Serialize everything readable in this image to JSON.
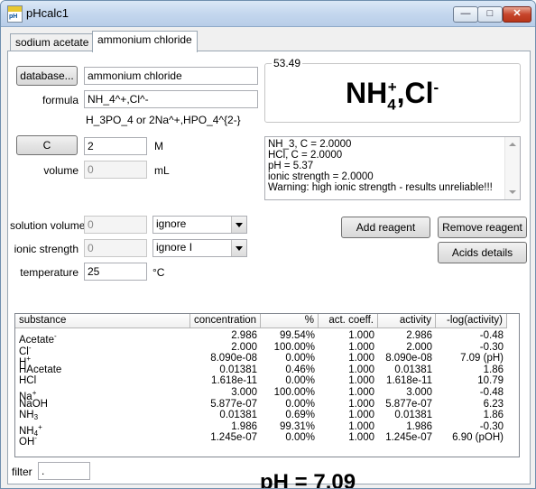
{
  "window": {
    "title": "pHcalc1",
    "minimize": "—",
    "maximize": "□",
    "close": "✕"
  },
  "tabs": [
    {
      "label": "sodium acetate"
    },
    {
      "label": "ammonium chloride"
    }
  ],
  "reagent": {
    "database_button": "database...",
    "name_value": "ammonium chloride",
    "formula_label": "formula",
    "formula_value": "NH_4^+,Cl^-",
    "formula_hint": "H_3PO_4 or 2Na^+,HPO_4^{2-}",
    "c_button": "C",
    "c_value": "2",
    "c_unit": "M",
    "volume_label": "volume",
    "volume_value": "0",
    "volume_unit": "mL"
  },
  "formula_display": {
    "molar_mass": "53.49",
    "base1": "NH",
    "sub1": "4",
    "sup1": "+",
    "sep": ",Cl",
    "sup2": "-"
  },
  "info_lines": [
    "NH_3, C = 2.0000",
    "HCl, C = 2.0000",
    "pH = 5.37",
    "ionic strength = 2.0000",
    "Warning: high ionic strength - results unreliable!!!"
  ],
  "solution": {
    "volume_label": "solution volume",
    "volume_value": "0",
    "volume_mode": "ignore",
    "ionic_label": "ionic strength",
    "ionic_value": "0",
    "ionic_mode": "ignore I",
    "temp_label": "temperature",
    "temp_value": "25",
    "temp_unit": "°C"
  },
  "buttons": {
    "add_reagent": "Add reagent",
    "remove_reagent": "Remove reagent",
    "acids_details": "Acids details"
  },
  "table": {
    "columns": [
      "substance",
      "concentration",
      "%",
      "act. coeff.",
      "activity",
      "-log(activity)"
    ],
    "rows": [
      {
        "name": "Acetate",
        "sub": "",
        "sup": "-",
        "conc": "2.986",
        "pct": "99.54%",
        "coeff": "1.000",
        "act": "2.986",
        "log": "-0.48"
      },
      {
        "name": "Cl",
        "sub": "",
        "sup": "-",
        "conc": "2.000",
        "pct": "100.00%",
        "coeff": "1.000",
        "act": "2.000",
        "log": "-0.30"
      },
      {
        "name": "H",
        "sub": "",
        "sup": "+",
        "conc": "8.090e-08",
        "pct": "0.00%",
        "coeff": "1.000",
        "act": "8.090e-08",
        "log": "7.09 (pH)"
      },
      {
        "name": "HAcetate",
        "sub": "",
        "sup": "",
        "conc": "0.01381",
        "pct": "0.46%",
        "coeff": "1.000",
        "act": "0.01381",
        "log": "1.86"
      },
      {
        "name": "HCl",
        "sub": "",
        "sup": "",
        "conc": "1.618e-11",
        "pct": "0.00%",
        "coeff": "1.000",
        "act": "1.618e-11",
        "log": "10.79"
      },
      {
        "name": "Na",
        "sub": "",
        "sup": "+",
        "conc": "3.000",
        "pct": "100.00%",
        "coeff": "1.000",
        "act": "3.000",
        "log": "-0.48"
      },
      {
        "name": "NaOH",
        "sub": "",
        "sup": "",
        "conc": "5.877e-07",
        "pct": "0.00%",
        "coeff": "1.000",
        "act": "5.877e-07",
        "log": "6.23"
      },
      {
        "name": "NH",
        "sub": "3",
        "sup": "",
        "conc": "0.01381",
        "pct": "0.69%",
        "coeff": "1.000",
        "act": "0.01381",
        "log": "1.86"
      },
      {
        "name": "NH",
        "sub": "4",
        "sup": "+",
        "conc": "1.986",
        "pct": "99.31%",
        "coeff": "1.000",
        "act": "1.986",
        "log": "-0.30"
      },
      {
        "name": "OH",
        "sub": "",
        "sup": "-",
        "conc": "1.245e-07",
        "pct": "0.00%",
        "coeff": "1.000",
        "act": "1.245e-07",
        "log": "6.90 (pOH)"
      }
    ]
  },
  "filter": {
    "label": "filter",
    "value": "."
  },
  "result": {
    "ph_text": "pH = 7.09"
  }
}
